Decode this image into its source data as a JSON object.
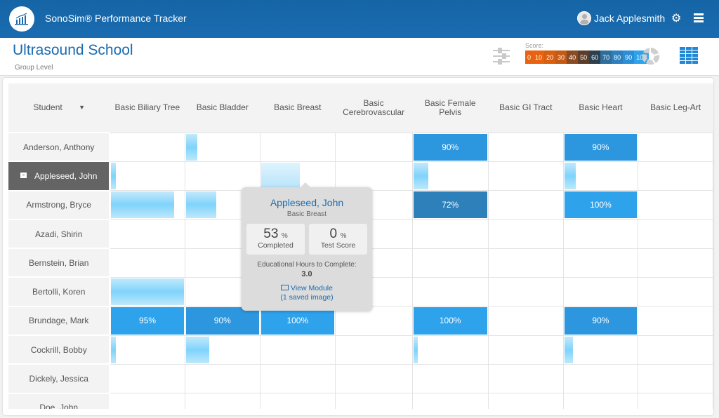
{
  "app": {
    "title": "SonoSim® Performance Tracker",
    "user_name": "Jack Applesmith"
  },
  "header": {
    "school": "Ultrasound School",
    "level": "Group Level",
    "score_label": "Score:",
    "score_scale": [
      {
        "label": "0",
        "color": "#e8620f"
      },
      {
        "label": "10",
        "color": "#e8620f"
      },
      {
        "label": "20",
        "color": "#d95f10"
      },
      {
        "label": "30",
        "color": "#c45a14"
      },
      {
        "label": "40",
        "color": "#8a4b23"
      },
      {
        "label": "50",
        "color": "#5c3d2a"
      },
      {
        "label": "60",
        "color": "#2c4050"
      },
      {
        "label": "70",
        "color": "#2e6e9c"
      },
      {
        "label": "80",
        "color": "#2c80bf"
      },
      {
        "label": "90",
        "color": "#2c8fd6"
      },
      {
        "label": "100",
        "color": "#2ea3ec"
      }
    ]
  },
  "table": {
    "student_header": "Student",
    "modules": [
      "Basic Biliary Tree",
      "Basic Bladder",
      "Basic Breast",
      "Basic Cerebrovascular",
      "Basic Female Pelvis",
      "Basic GI Tract",
      "Basic Heart",
      "Basic Leg-Art"
    ],
    "rows": [
      {
        "name": "Anderson, Anthony",
        "selected": false,
        "cells": [
          null,
          {
            "progress": 16
          },
          null,
          null,
          {
            "score": 90,
            "label": "90%",
            "color": "#2c97de"
          },
          null,
          {
            "score": 90,
            "label": "90%",
            "color": "#2c97de"
          },
          null
        ]
      },
      {
        "name": "Appleseed, John",
        "selected": true,
        "cells": [
          {
            "progress": 6
          },
          null,
          {
            "progress": 53,
            "light": true
          },
          null,
          {
            "progress": 20
          },
          null,
          {
            "progress": 16
          },
          null
        ]
      },
      {
        "name": "Armstrong, Bryce",
        "selected": false,
        "cells": [
          {
            "progress": 87
          },
          {
            "progress": 42
          },
          null,
          null,
          {
            "score": 72,
            "label": "72%",
            "color": "#2e80bb"
          },
          null,
          {
            "score": 100,
            "label": "100%",
            "color": "#2ea3ec"
          },
          null
        ]
      },
      {
        "name": "Azadi, Shirin",
        "selected": false,
        "cells": [
          null,
          null,
          null,
          null,
          null,
          null,
          null,
          null
        ]
      },
      {
        "name": "Bernstein, Brian",
        "selected": false,
        "cells": [
          null,
          null,
          null,
          null,
          null,
          null,
          null,
          null
        ]
      },
      {
        "name": "Bertolli, Koren",
        "selected": false,
        "cells": [
          {
            "progress": 100
          },
          null,
          null,
          null,
          null,
          null,
          null,
          null
        ]
      },
      {
        "name": "Brundage, Mark",
        "selected": false,
        "cells": [
          {
            "score": 95,
            "label": "95%",
            "color": "#2ea3ec"
          },
          {
            "score": 90,
            "label": "90%",
            "color": "#2c97de"
          },
          {
            "score": 100,
            "label": "100%",
            "color": "#2ea3ec"
          },
          null,
          {
            "score": 100,
            "label": "100%",
            "color": "#2ea3ec"
          },
          null,
          {
            "score": 90,
            "label": "90%",
            "color": "#2c97de"
          },
          null
        ]
      },
      {
        "name": "Cockrill, Bobby",
        "selected": false,
        "cells": [
          {
            "progress": 6
          },
          {
            "progress": 32
          },
          null,
          null,
          {
            "progress": 6
          },
          null,
          {
            "progress": 12
          },
          null
        ]
      },
      {
        "name": "Dickely, Jessica",
        "selected": false,
        "cells": [
          null,
          null,
          null,
          null,
          null,
          null,
          null,
          null
        ]
      },
      {
        "name": "Doe, John",
        "selected": false,
        "cells": [
          null,
          null,
          null,
          null,
          null,
          null,
          null,
          null
        ]
      }
    ]
  },
  "tooltip": {
    "student": "Appleseed, John",
    "module": "Basic Breast",
    "completed_value": "53",
    "completed_unit": "%",
    "completed_label": "Completed",
    "test_value": "0",
    "test_unit": "%",
    "test_label": "Test Score",
    "hours_label": "Educational Hours to Complete:",
    "hours_value": "3.0",
    "view_module": "View Module",
    "saved_images": "(1 saved image)"
  }
}
